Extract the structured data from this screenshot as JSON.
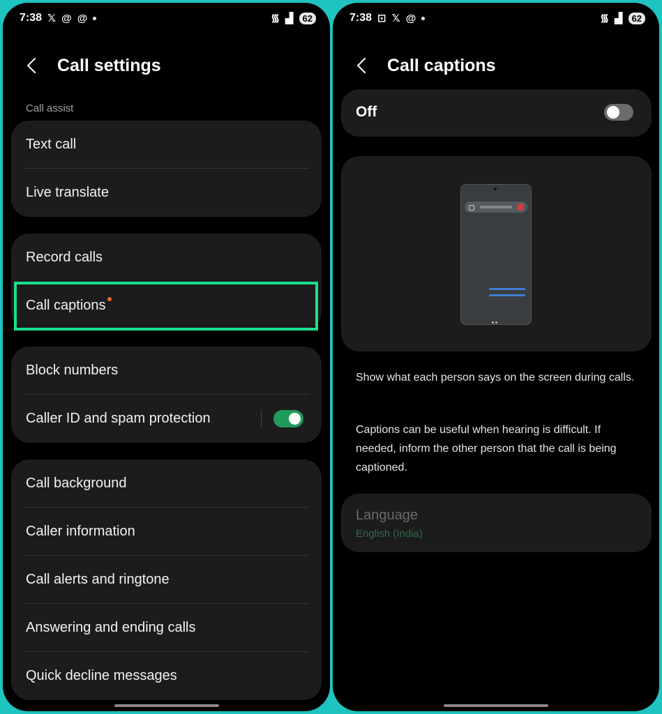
{
  "status_bar": {
    "time": "7:38",
    "battery": "62",
    "left_icons": [
      "x-icon",
      "threads-icon",
      "threads-icon",
      "dot-icon"
    ],
    "right_icons": [
      "wifi-icon",
      "signal-icon"
    ]
  },
  "left_screen": {
    "title": "Call settings",
    "section_label": "Call assist",
    "group1": [
      "Text call",
      "Live translate"
    ],
    "group2": [
      "Record calls",
      "Call captions"
    ],
    "group3": [
      "Block numbers",
      "Caller ID and spam protection"
    ],
    "group4": [
      "Call background",
      "Caller information",
      "Call alerts and ringtone",
      "Answering and ending calls",
      "Quick decline messages"
    ],
    "caller_id_toggle": "on",
    "highlight_color": "#1ae08e"
  },
  "right_screen": {
    "title": "Call captions",
    "toggle_label": "Off",
    "toggle_state": "off",
    "description1": "Show what each person says on the screen during calls.",
    "description2": "Captions can be useful when hearing is difficult. If needed, inform the other person that the call is being captioned.",
    "language_title": "Language",
    "language_value": "English (India)"
  },
  "colors": {
    "accent_green": "#219b5b",
    "frame": "#1fc3bf"
  }
}
